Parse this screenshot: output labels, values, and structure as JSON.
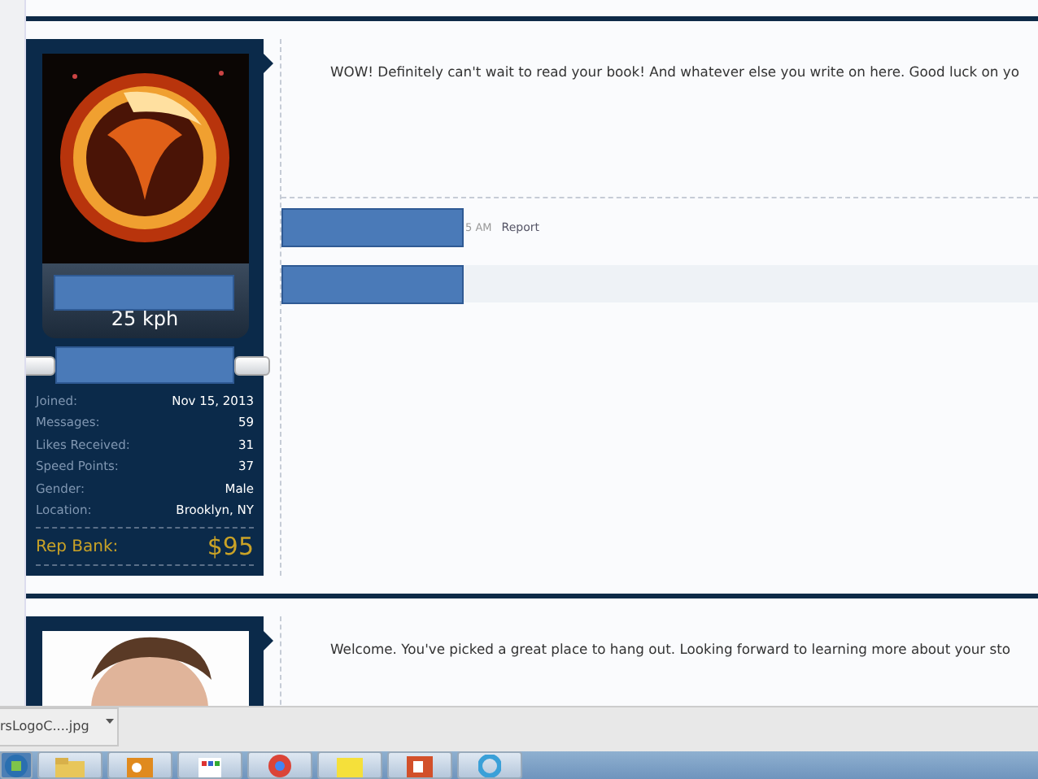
{
  "posts": [
    {
      "author": {
        "rank": "25 kph",
        "stats": [
          {
            "label": "Joined:",
            "value": "Nov 15, 2013"
          },
          {
            "label": "Messages:",
            "value": "59"
          },
          {
            "label": "Likes Received:",
            "value": "31"
          },
          {
            "label": "Speed Points:",
            "value": "37"
          },
          {
            "label": "Gender:",
            "value": "Male"
          },
          {
            "label": "Location:",
            "value": "Brooklyn, NY"
          }
        ],
        "rep_bank": {
          "label": "Rep Bank:",
          "value": "$95"
        }
      },
      "message": "WOW! Definitely can't wait to read your book! And whatever else you write on here. Good luck on yo",
      "time": "5 AM",
      "actions": [
        "Report"
      ]
    },
    {
      "message": "Welcome. You've picked a great place to hang out. Looking forward to learning more about your sto"
    }
  ],
  "download_bar": {
    "items": [
      {
        "name": "rsLogoC....jpg"
      }
    ]
  }
}
